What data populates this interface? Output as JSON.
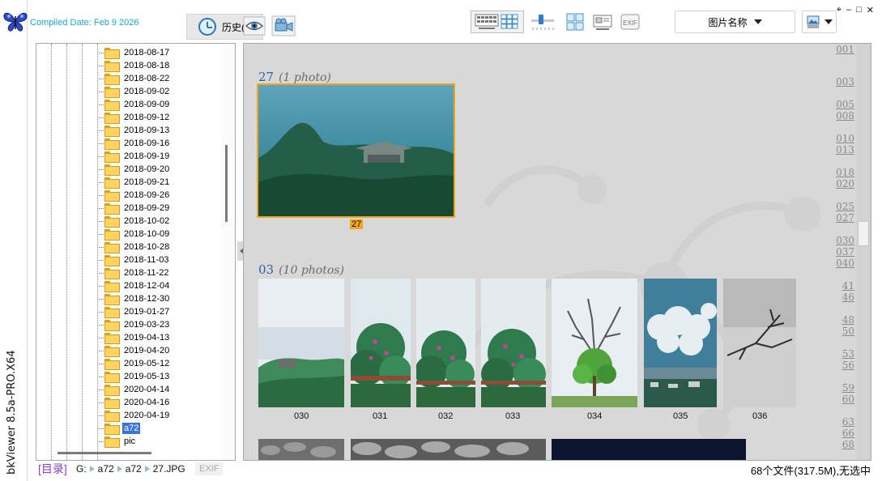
{
  "app": {
    "vertical_title": "bkViewer 8.5a-PRO.X64",
    "compiled": "Compiled Date: Feb  9 2026",
    "window_controls": [
      "⌖",
      "–",
      "□",
      "✕"
    ]
  },
  "toolbar": {
    "history_label": "历史(H)",
    "sort_label": "图片名称",
    "exif_label": "EXIF",
    "icons": [
      "eye-icon",
      "video-camera-icon",
      "list-view-icon",
      "grid-view-icon",
      "thumb-size-slider",
      "large-grid-icon",
      "detail-view-icon",
      "exif-icon",
      "image-menu-icon"
    ]
  },
  "tree": {
    "folders": [
      "2018-08-17",
      "2018-08-18",
      "2018-08-22",
      "2018-09-02",
      "2018-09-09",
      "2018-09-12",
      "2018-09-13",
      "2018-09-16",
      "2018-09-19",
      "2018-09-20",
      "2018-09-21",
      "2018-09-26",
      "2018-09-29",
      "2018-10-02",
      "2018-10-09",
      "2018-10-28",
      "2018-11-03",
      "2018-11-22",
      "2018-12-04",
      "2018-12-30",
      "2019-01-27",
      "2019-03-23",
      "2019-04-13",
      "2019-04-20",
      "2019-05-12",
      "2019-05-13",
      "2020-04-14",
      "2020-04-16",
      "2020-04-19",
      "a72",
      "pic"
    ],
    "selected": "a72"
  },
  "groups": [
    {
      "name": "27",
      "count": "(1 photo)",
      "photos": [
        "27"
      ]
    },
    {
      "name": "03",
      "count": "(10 photos)",
      "photos": [
        "030",
        "031",
        "032",
        "033",
        "034",
        "035",
        "036"
      ]
    }
  ],
  "index": [
    "001",
    "003",
    "005",
    "008",
    "010",
    "013",
    "018",
    "020",
    "025",
    "027",
    "030",
    "037",
    "040",
    "41",
    "46",
    "48",
    "50",
    "53",
    "56",
    "59",
    "60",
    "63",
    "66",
    "68"
  ],
  "status": {
    "dir_label": "[目录]",
    "path": [
      "G:",
      "a72",
      "a72",
      "27.JPG"
    ],
    "exif": "EXIF",
    "count": "68个文件(317.5M),无选中"
  },
  "colors": {
    "accent": "#3875d7",
    "selection": "#f2a41a",
    "compiled": "#1fa4d6",
    "group_title": "#2d5ea6"
  }
}
